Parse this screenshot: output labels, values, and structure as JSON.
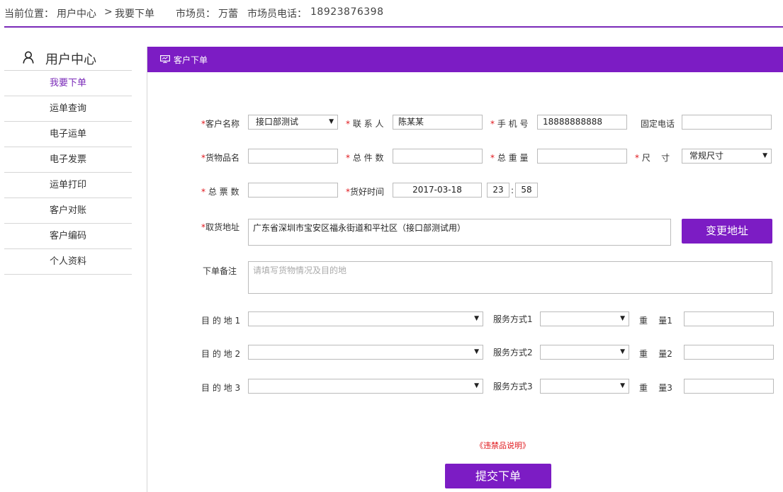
{
  "breadcrumb": {
    "prefix": "当前位置：",
    "root": "用户中心",
    "sep": ">",
    "current": "我要下单"
  },
  "salesman": {
    "label": "市场员：",
    "name": "万蕾",
    "phone_label": "市场员电话：",
    "phone": "18923876398"
  },
  "sidebar": {
    "title": "用户中心",
    "items": [
      {
        "label": "我要下单",
        "active": true
      },
      {
        "label": "运单查询"
      },
      {
        "label": "电子运单"
      },
      {
        "label": "电子发票"
      },
      {
        "label": "运单打印"
      },
      {
        "label": "客户对账"
      },
      {
        "label": "客户编码"
      },
      {
        "label": "个人资料"
      }
    ]
  },
  "panel": {
    "title": "客户下单"
  },
  "form": {
    "customer_name": {
      "label": "客户名称",
      "value": "接口部测试"
    },
    "contact": {
      "label": "联 系 人",
      "value": "陈某某"
    },
    "mobile": {
      "label": "手 机 号",
      "value": "18888888888"
    },
    "landline": {
      "label": "固定电话",
      "value": ""
    },
    "goods_name": {
      "label": "货物品名",
      "value": ""
    },
    "pieces": {
      "label": "总 件 数",
      "value": ""
    },
    "weight": {
      "label": "总 重 量",
      "value": ""
    },
    "size": {
      "label": "尺    寸",
      "value": "常规尺寸"
    },
    "tickets": {
      "label": "总 票 数",
      "value": ""
    },
    "ready_time": {
      "label": "货好时间",
      "date": "2017-03-18",
      "hour": "23",
      "sep": ":",
      "minute": "58"
    },
    "pickup_address": {
      "label": "取货地址",
      "value": "广东省深圳市宝安区福永街道和平社区（接口部测试用）"
    },
    "change_address_button": "变更地址",
    "remark": {
      "label": "下单备注",
      "placeholder": "请填写货物情况及目的地"
    },
    "destinations": [
      {
        "label": "目 的 地 1",
        "service_label": "服务方式1",
        "weight_label": "重    量1"
      },
      {
        "label": "目 的 地 2",
        "service_label": "服务方式2",
        "weight_label": "重    量2"
      },
      {
        "label": "目 的 地 3",
        "service_label": "服务方式3",
        "weight_label": "重    量3"
      }
    ],
    "required_mark": "*"
  },
  "prohibited_link": "《违禁品说明》",
  "submit_button": "提交下单",
  "colors": {
    "accent": "#7c1cc4",
    "required": "#e0161b"
  }
}
